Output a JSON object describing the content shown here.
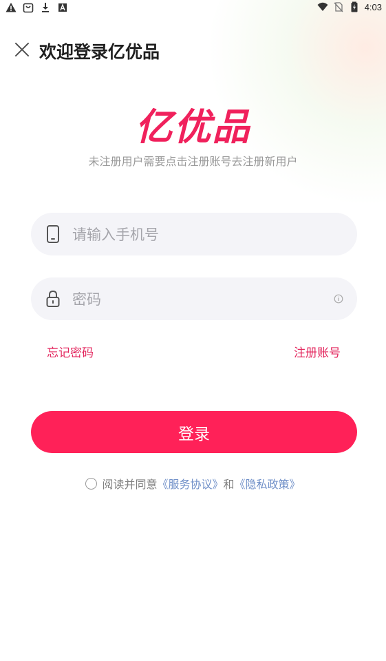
{
  "status_bar": {
    "time": "4:03",
    "left_icons": [
      "warning-icon",
      "shopping-bag-icon",
      "download-icon",
      "font-app-icon"
    ],
    "right_icons": [
      "wifi-icon",
      "no-sim-icon",
      "battery-icon"
    ]
  },
  "header": {
    "close_icon": "close-icon",
    "title": "欢迎登录亿优品"
  },
  "brand": {
    "logo_text": "亿优品",
    "subtitle": "未注册用户需要点击注册账号去注册新用户",
    "accent_color": "#ff2158"
  },
  "form": {
    "phone": {
      "icon": "phone-icon",
      "placeholder": "请输入手机号",
      "value": ""
    },
    "password": {
      "icon": "lock-icon",
      "placeholder": "密码",
      "value": "",
      "toggle_icon": "eye-icon"
    },
    "forgot_label": "忘记密码",
    "register_label": "注册账号",
    "login_label": "登录"
  },
  "agreement": {
    "checked": false,
    "prefix": "阅读并同意",
    "service_link": "《服务协议》",
    "conjunction": "和",
    "privacy_link": "《隐私政策》"
  }
}
